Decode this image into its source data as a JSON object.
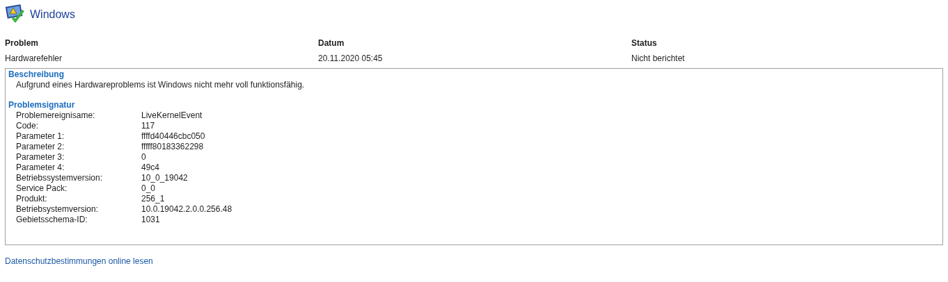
{
  "header": {
    "title": "Windows"
  },
  "table": {
    "columns": [
      "Problem",
      "Datum",
      "Status"
    ],
    "row": [
      "Hardwarefehler",
      "20.11.2020 05:45",
      "Nicht berichtet"
    ]
  },
  "details": {
    "description_heading": "Beschreibung",
    "description": "Aufgrund eines Hardwareproblems ist Windows nicht mehr voll funktionsfähig.",
    "signature_heading": "Problemsignatur",
    "signature": [
      {
        "label": "Problemereignisame:",
        "value": "LiveKernelEvent"
      },
      {
        "label": "Code:",
        "value": "117"
      },
      {
        "label": "Parameter 1:",
        "value": "ffffd40446cbc050"
      },
      {
        "label": "Parameter 2:",
        "value": "fffff80183362298"
      },
      {
        "label": "Parameter 3:",
        "value": "0"
      },
      {
        "label": "Parameter 4:",
        "value": "49c4"
      },
      {
        "label": "Betriebssystemversion:",
        "value": "10_0_19042"
      },
      {
        "label": "Service Pack:",
        "value": "0_0"
      },
      {
        "label": "Produkt:",
        "value": "256_1"
      },
      {
        "label": "Betriebsystemversion:",
        "value": "10.0.19042.2.0.0.256.48"
      },
      {
        "label": "Gebietsschema-ID:",
        "value": "1031"
      }
    ]
  },
  "privacy_link": "Datenschutzbestimmungen online lesen"
}
